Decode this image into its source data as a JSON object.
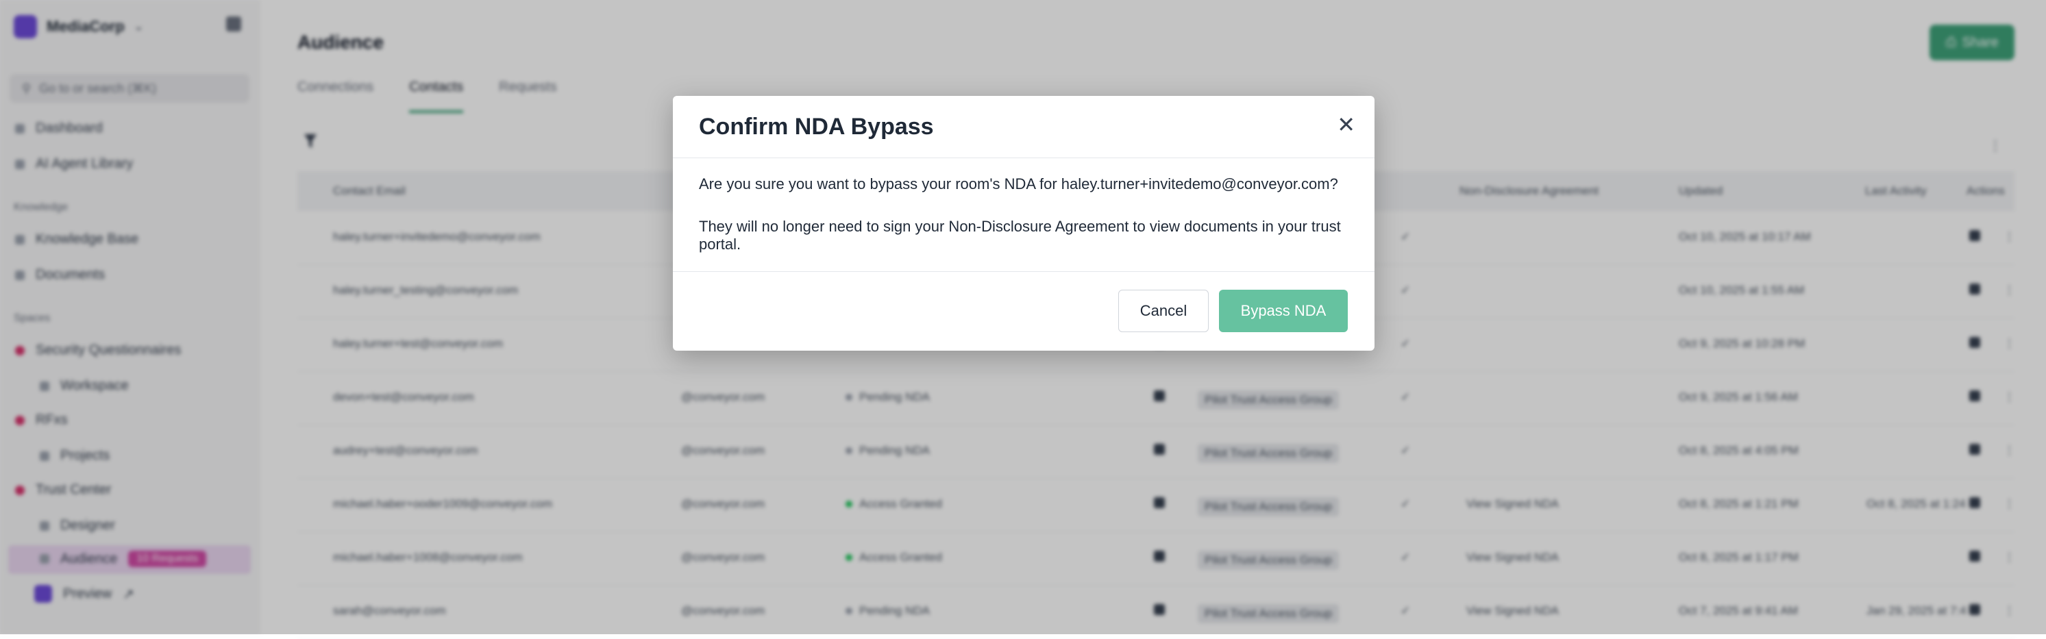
{
  "modal": {
    "title": "Confirm NDA Bypass",
    "close_icon": "close-icon",
    "message": "Are you sure you want to bypass your room's NDA for haley.turner+invitedemo@conveyor.com?",
    "detail": "They will no longer need to sign your Non-Disclosure Agreement to view documents in your trust portal.",
    "cancel_label": "Cancel",
    "confirm_label": "Bypass NDA",
    "confirm_color": "#66c2a0"
  },
  "sidebar": {
    "brand": "MediaCorp",
    "search_placeholder": "Go to or search (⌘K)",
    "items": [
      {
        "label": "Dashboard"
      },
      {
        "label": "AI Agent Library"
      }
    ],
    "knowledge_label": "Knowledge",
    "knowledge_items": [
      {
        "label": "Knowledge Base"
      },
      {
        "label": "Documents"
      }
    ],
    "spaces_label": "Spaces",
    "spaces_items": [
      {
        "label": "Security Questionnaires"
      },
      {
        "label": "Workspace"
      },
      {
        "label": "RFxs"
      },
      {
        "label": "Projects"
      },
      {
        "label": "Trust Center"
      },
      {
        "label": "Designer"
      },
      {
        "label": "Audience"
      },
      {
        "label": "Preview"
      }
    ],
    "requests_badge": "10 Requests"
  },
  "main": {
    "title": "Audience",
    "share_label": "Share",
    "tabs": [
      "Connections",
      "Contacts",
      "Requests"
    ],
    "columns": [
      "Contact Email",
      "Non-Disclosure Agreement",
      "Updated",
      "Last Activity",
      "Actions"
    ],
    "rows": [
      {
        "email": "haley.turner+invitedemo@conveyor.com",
        "domain": "",
        "status": "",
        "group": "",
        "nda": "",
        "updated": "Oct 10, 2025 at 10:17 AM",
        "activity": ""
      },
      {
        "email": "haley.turner_testing@conveyor.com",
        "domain": "",
        "status": "",
        "group": "",
        "nda": "",
        "updated": "Oct 10, 2025 at 1:55 AM",
        "activity": ""
      },
      {
        "email": "haley.turner+test@conveyor.com",
        "domain": "",
        "status": "",
        "group": "",
        "nda": "",
        "updated": "Oct 9, 2025 at 10:28 PM",
        "activity": ""
      },
      {
        "email": "devon+test@conveyor.com",
        "domain": "@conveyor.com",
        "status": "Pending NDA",
        "group": "Pilot Trust Access Group",
        "nda": "",
        "updated": "Oct 9, 2025 at 1:56 AM",
        "activity": ""
      },
      {
        "email": "audrey+test@conveyor.com",
        "domain": "@conveyor.com",
        "status": "Pending NDA",
        "group": "Pilot Trust Access Group",
        "nda": "",
        "updated": "Oct 8, 2025 at 4:05 PM",
        "activity": ""
      },
      {
        "email": "michael.haber+ooder1009@conveyor.com",
        "domain": "@conveyor.com",
        "status": "Access Granted",
        "group": "Pilot Trust Access Group",
        "nda": "View Signed NDA",
        "updated": "Oct 8, 2025 at 1:21 PM",
        "activity": "Oct 8, 2025 at 1:24 P"
      },
      {
        "email": "michael.haber+1008@conveyor.com",
        "domain": "@conveyor.com",
        "status": "Access Granted",
        "group": "Pilot Trust Access Group",
        "nda": "View Signed NDA",
        "updated": "Oct 8, 2025 at 1:17 PM",
        "activity": ""
      },
      {
        "email": "sarah@conveyor.com",
        "domain": "@conveyor.com",
        "status": "Pending NDA",
        "group": "Pilot Trust Access Group",
        "nda": "View Signed NDA",
        "updated": "Oct 7, 2025 at 9:41 AM",
        "activity": "Jan 29, 2025 at 7:4"
      }
    ]
  }
}
